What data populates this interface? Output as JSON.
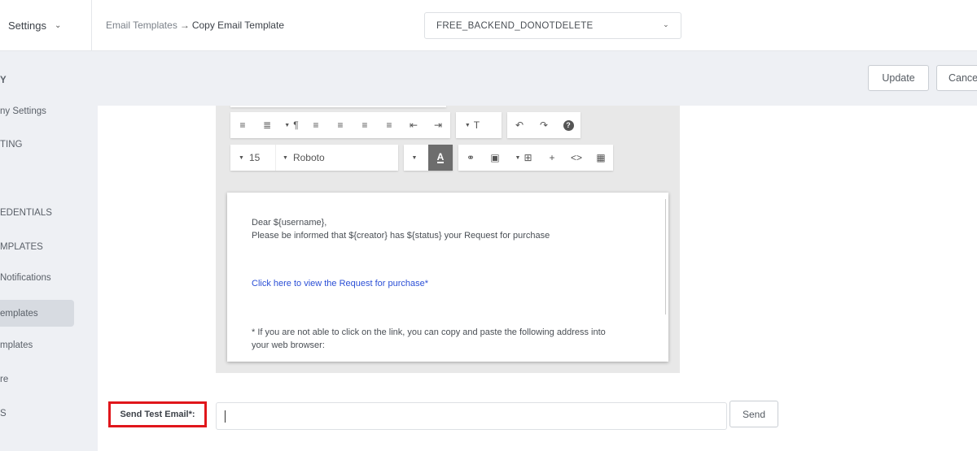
{
  "topbar": {
    "settings_label": "Settings",
    "breadcrumb_parent": "Email Templates",
    "breadcrumb_arrow": "→",
    "breadcrumb_current": "Copy Email Template",
    "store_select_value": "FREE_BACKEND_DONOTDELETE"
  },
  "sidebar": {
    "items": [
      "Y",
      "ny Settings",
      "TING",
      "EDENTIALS",
      "MPLATES",
      "Notifications",
      "emplates",
      "mplates",
      "re",
      "S"
    ],
    "active_index": 6
  },
  "actions": {
    "update_label": "Update",
    "cancel_label": "Cance"
  },
  "editor": {
    "font_size": "15",
    "font_family": "Roboto",
    "color_button_letter": "A",
    "body_lines": {
      "greeting": "Dear ${username},",
      "line1": "Please be informed that ${creator} has ${status} your Request for purchase",
      "link": "Click here to view the Request for purchase*",
      "footnote1": "* If you are not able to click on the link, you can copy and paste the following address into",
      "footnote2": "your web browser:"
    }
  },
  "test_email": {
    "label": "Send Test Email*:",
    "input_value": "",
    "send_label": "Send"
  }
}
